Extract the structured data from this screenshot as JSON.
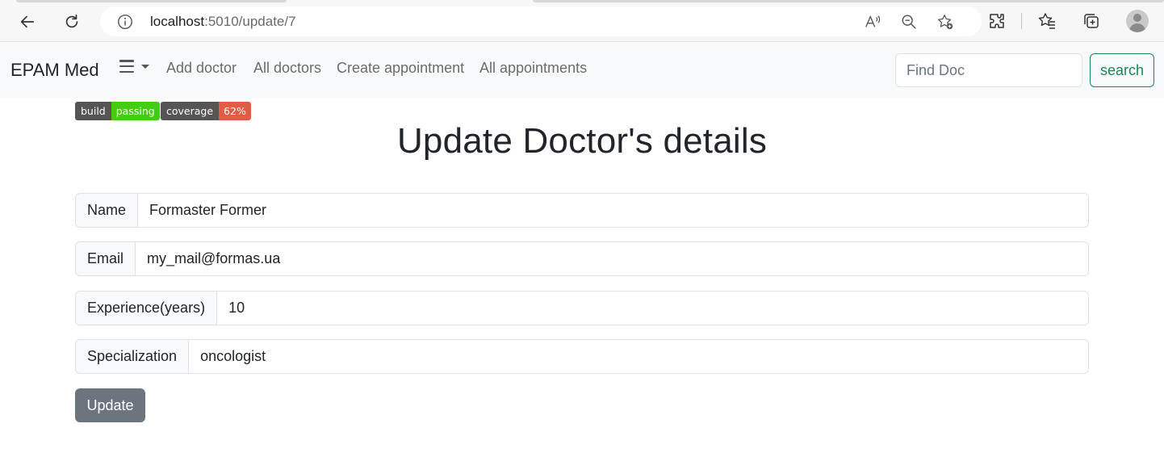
{
  "browser": {
    "url_host": "localhost",
    "url_path": ":5010/update/7"
  },
  "navbar": {
    "brand": "EPAM Med",
    "links": [
      "Add doctor",
      "All doctors",
      "Create appointment",
      "All appointments"
    ],
    "search_placeholder": "Find Doc",
    "search_button": "search"
  },
  "badges": [
    {
      "label": "build",
      "value": "passing",
      "color": "#4c1"
    },
    {
      "label": "coverage",
      "value": "62%",
      "color": "#e05d44"
    }
  ],
  "page": {
    "title": "Update Doctor's details"
  },
  "form": {
    "fields": [
      {
        "label": "Name",
        "value": "Formaster Former"
      },
      {
        "label": "Email",
        "value": "my_mail@formas.ua"
      },
      {
        "label": "Experience(years)",
        "value": "10"
      },
      {
        "label": "Specialization",
        "value": "oncologist"
      }
    ],
    "submit_label": "Update"
  },
  "colors": {
    "success": "#198754",
    "secondary": "#6c757d",
    "navbar_bg": "#f8f9fa"
  }
}
